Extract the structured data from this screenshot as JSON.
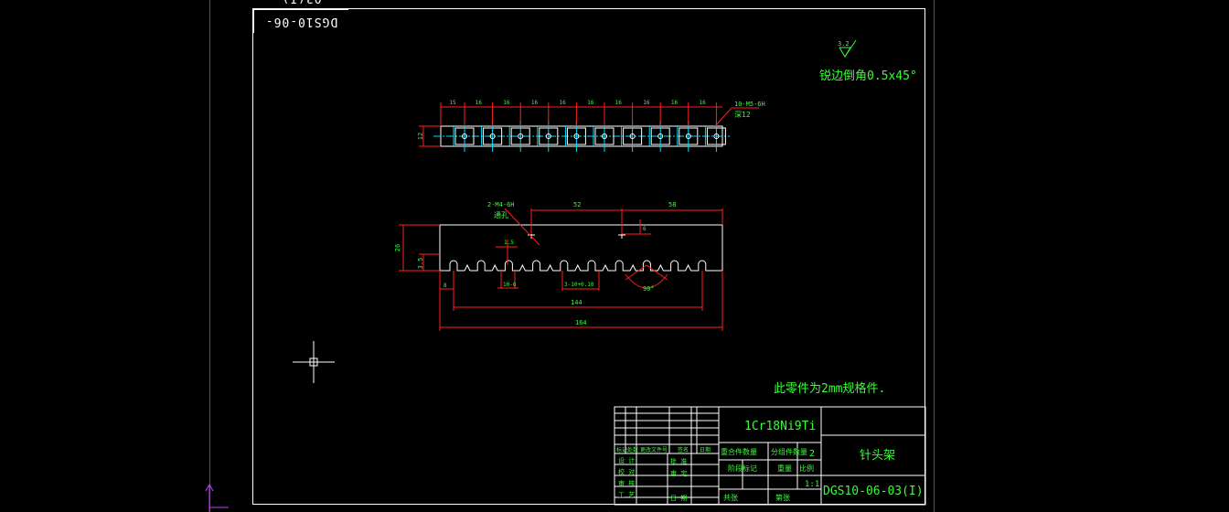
{
  "drawing": {
    "drawing_number": "DGS10-06-03(I)",
    "roughness_symbol_value": "3.2",
    "edge_note": "锐边倒角0.5x45°",
    "material_note": "此零件为2mm规格件."
  },
  "top_view": {
    "pitch_labels": [
      "15",
      "16",
      "16",
      "16",
      "16",
      "16",
      "16",
      "16",
      "16",
      "16"
    ],
    "height_label": "12",
    "thread_callout": "10-M5-6H",
    "thread_depth": "深12"
  },
  "front_view": {
    "hole_callout": "2-M4-6H",
    "hole_type": "通孔",
    "dim_52": "52",
    "dim_58": "58",
    "dim_height_26": "26",
    "dim_3_5": "3.5",
    "dim_1_5": "1.5",
    "dim_slot": "10-6",
    "dim_slot_width": "3-10+0.10",
    "dim_8": "8",
    "dim_144": "144",
    "dim_164": "164",
    "dim_angle": "90°",
    "dim_small": "6"
  },
  "title_block": {
    "material": "1Cr18Ni9Ti",
    "part_name": "针头架",
    "part_number": "DGS10-06-03(I)",
    "scale": "1:1",
    "quantity": "2",
    "row_labels": [
      "标记处数",
      "更改文件号",
      "签名",
      "日期"
    ],
    "design_labels": [
      "设 计",
      "校 对",
      "审 核",
      "工 艺"
    ],
    "approval_labels": [
      "审 定",
      "批 准",
      "日 期"
    ],
    "info_labels": [
      "重合件数量",
      "分组件数量",
      "阶段标记",
      "重量",
      "比例",
      "共张",
      "第张"
    ]
  }
}
